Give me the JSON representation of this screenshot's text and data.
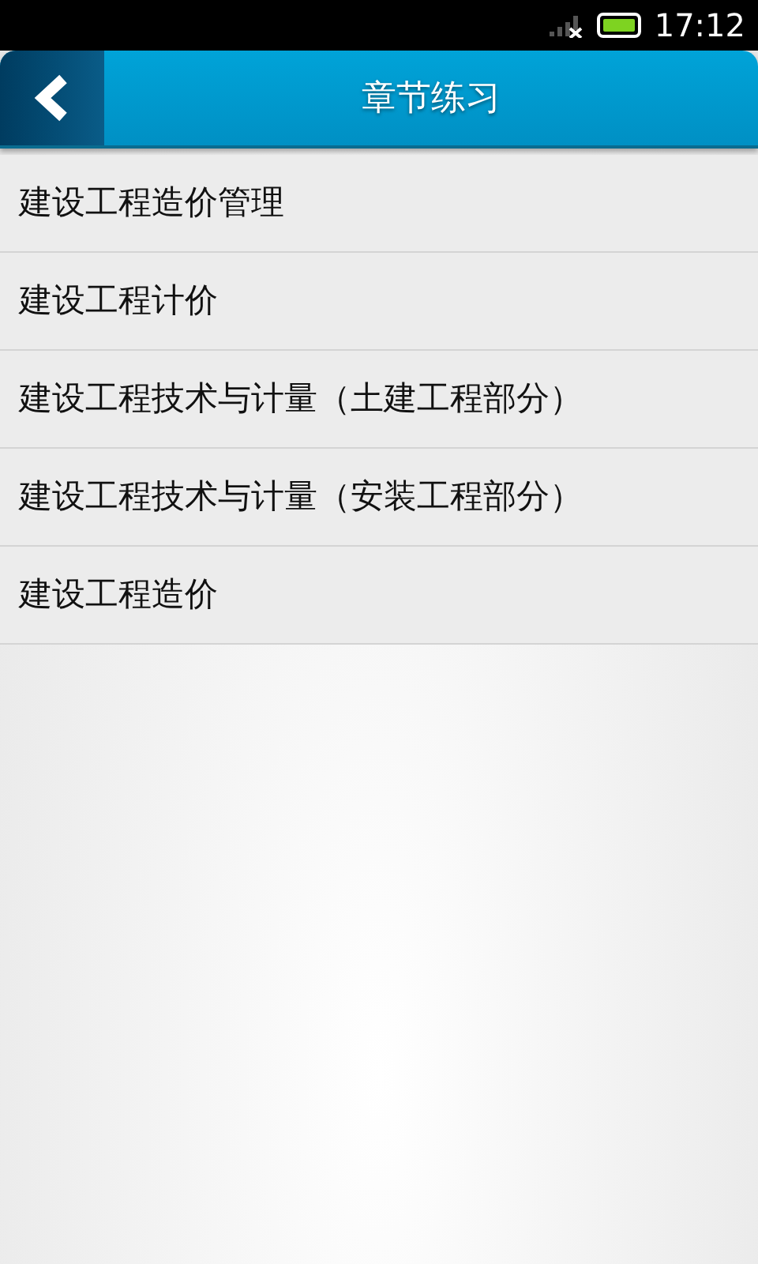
{
  "status_bar": {
    "time": "17:12"
  },
  "header": {
    "title": "章节练习"
  },
  "items": [
    {
      "label": "建设工程造价管理"
    },
    {
      "label": "建设工程计价"
    },
    {
      "label": "建设工程技术与计量（土建工程部分）"
    },
    {
      "label": "建设工程技术与计量（安装工程部分）"
    },
    {
      "label": "建设工程造价"
    }
  ]
}
